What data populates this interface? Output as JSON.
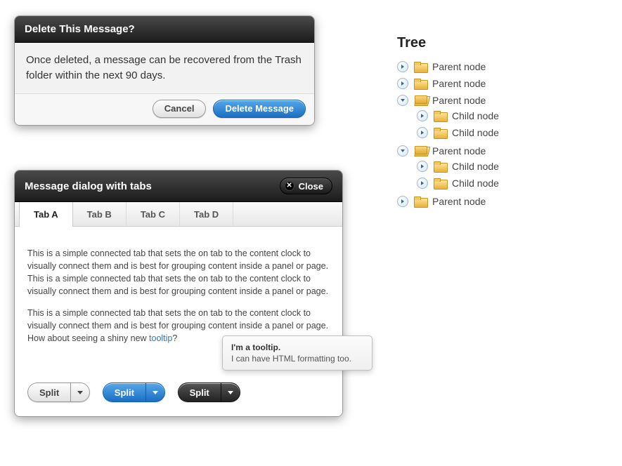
{
  "confirm": {
    "title": "Delete This Message?",
    "body": "Once deleted, a message can be recovered from the Trash folder within the next 90 days.",
    "cancel_label": "Cancel",
    "ok_label": "Delete Message"
  },
  "tabs_dialog": {
    "title": "Message dialog with tabs",
    "close_label": "Close",
    "tabs": [
      {
        "label": "Tab A",
        "active": true
      },
      {
        "label": "Tab B",
        "active": false
      },
      {
        "label": "Tab C",
        "active": false
      },
      {
        "label": "Tab D",
        "active": false
      }
    ],
    "para1": "This is a simple connected tab that sets the on tab to the content clock to visually connect them and is best for grouping content inside a panel or page. This is a simple connected tab that sets the on tab to the content clock to visually connect them and is best for grouping content inside a panel or page.",
    "para2_pre": "This is a simple connected tab that sets the on tab to the content clock to visually connect them and is best for grouping content inside a panel or page. How about seeing a shiny new ",
    "tooltip_link": "tooltip",
    "para2_post": "?"
  },
  "tooltip": {
    "line1": "I'm a tooltip.",
    "line2": "I can have HTML formatting too."
  },
  "splits": {
    "label": "Split"
  },
  "tree": {
    "title": "Tree",
    "nodes": [
      {
        "label": "Parent node",
        "open": false,
        "children": []
      },
      {
        "label": "Parent node",
        "open": false,
        "children": []
      },
      {
        "label": "Parent node",
        "open": true,
        "children": [
          {
            "label": "Child node",
            "open": false
          },
          {
            "label": "Child node",
            "open": false
          }
        ]
      },
      {
        "label": "Parent node",
        "open": true,
        "children": [
          {
            "label": "Child node",
            "open": false
          },
          {
            "label": "Child node",
            "open": false
          }
        ]
      },
      {
        "label": "Parent node",
        "open": false,
        "children": []
      }
    ]
  }
}
